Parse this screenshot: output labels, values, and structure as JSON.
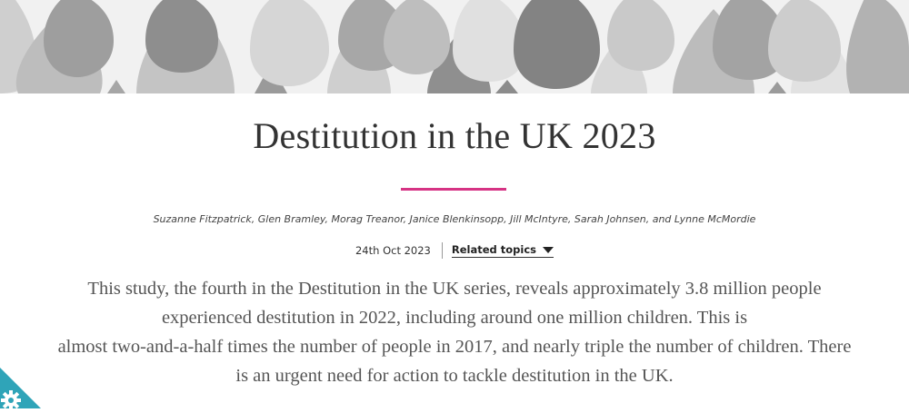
{
  "hero": {
    "image_name": "raindrops-banner",
    "colors": [
      "#d9d9d9",
      "#a6a6a6",
      "#8c8c8c",
      "#bfbfbf",
      "#777777"
    ]
  },
  "article": {
    "title": "Destitution in the UK 2023",
    "accent_color": "#d63384",
    "authors": "Suzanne Fitzpatrick, Glen Bramley, Morag Treanor, Janice Blenkinsopp, Jill McIntyre, Sarah Johnsen, and Lynne McMordie",
    "date": "24th Oct 2023",
    "related_topics_label": "Related topics",
    "summary_lines": [
      "This study, the fourth in the Destitution in the UK series, reveals approximately 3.8 million people",
      "experienced destitution in 2022, including around one million children. This is",
      "almost two-and-a-half times the number of people in 2017, and nearly triple the number of children. There",
      "is an urgent need for action to tackle destitution in the UK."
    ]
  },
  "widget": {
    "icon": "gear-icon",
    "color": "#2fa4b8"
  }
}
